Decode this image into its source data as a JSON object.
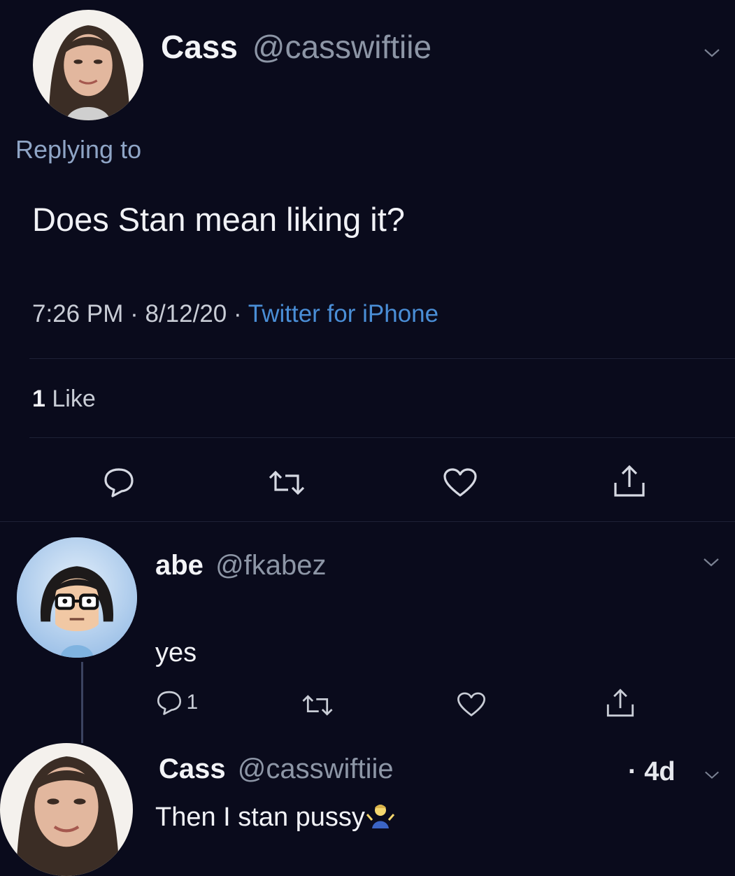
{
  "main_tweet": {
    "display_name": "Cass",
    "handle": "@casswiftiie",
    "replying_to": "Replying to",
    "text": "Does Stan mean liking it?",
    "time": "7:26 PM",
    "sep1": "·",
    "date": "8/12/20",
    "sep2": "·",
    "source": "Twitter for iPhone",
    "like_count": "1",
    "like_label": "Like"
  },
  "reply1": {
    "display_name": "abe",
    "handle": "@fkabez",
    "text": "yes",
    "reply_count": "1"
  },
  "reply2": {
    "display_name": "Cass",
    "handle": "@casswiftiie",
    "age": "· 4d",
    "text": "Then I stan pussy"
  },
  "icons": {
    "reply": "reply-icon",
    "retweet": "retweet-icon",
    "like": "heart-icon",
    "share": "share-icon",
    "more": "chevron-down-icon",
    "emoji": "shrug-emoji-icon"
  },
  "colors": {
    "background": "#0a0b1c",
    "link": "#4a8ed6",
    "muted": "#8d96a6"
  }
}
